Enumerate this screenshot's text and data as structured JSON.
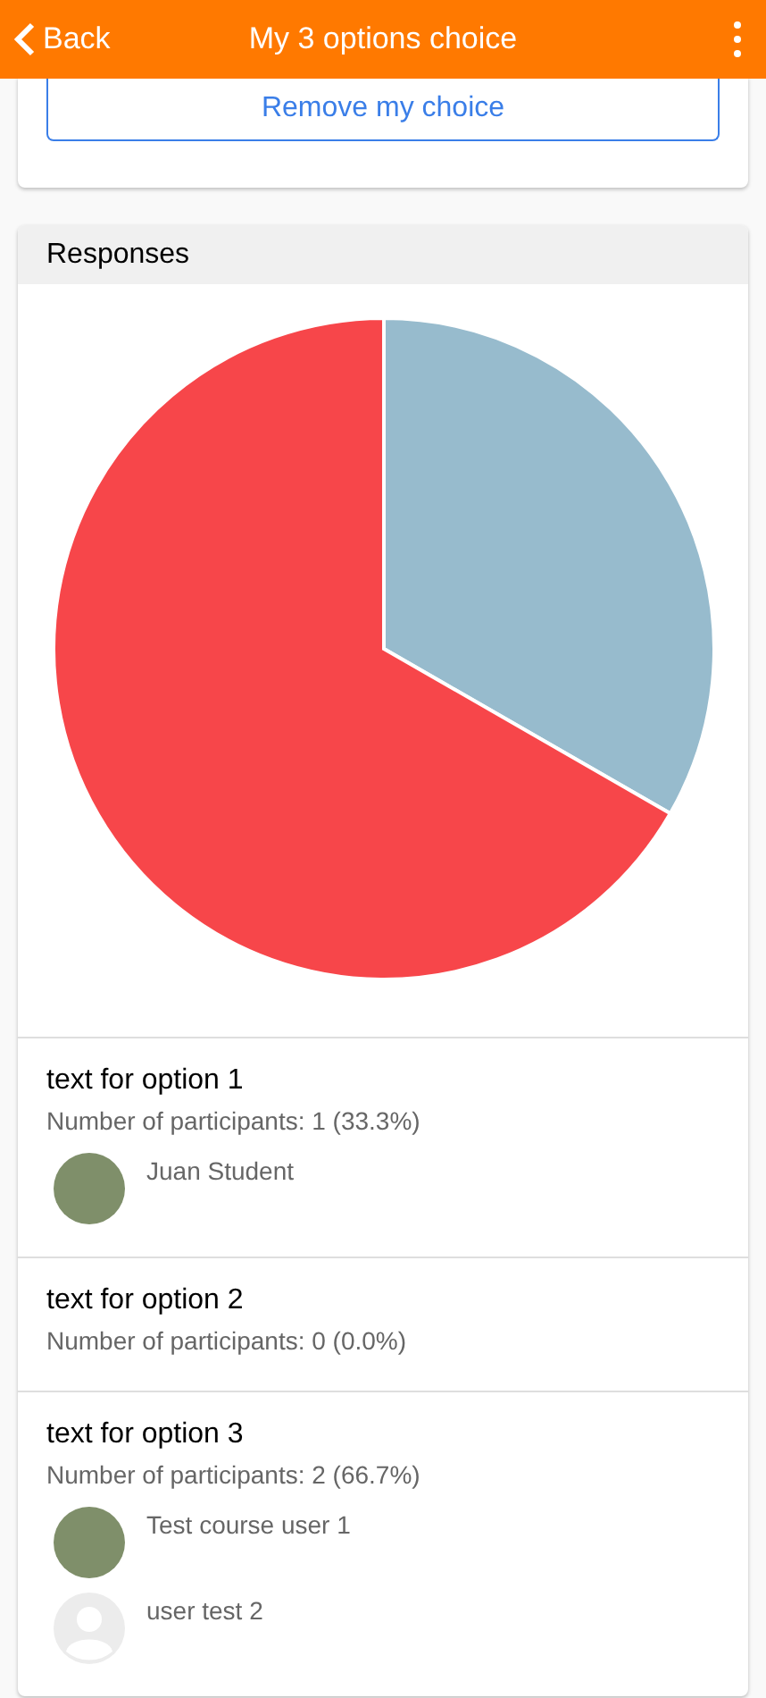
{
  "header": {
    "back": "Back",
    "title": "My 3 options choice"
  },
  "remove_button": "Remove my choice",
  "responses": {
    "title": "Responses",
    "chart_data": {
      "type": "pie",
      "values": [
        33.3,
        66.7
      ],
      "colors": [
        "#97bbcd",
        "#f7464a"
      ]
    },
    "options": [
      {
        "title": "text for option 1",
        "count": "Number of participants: 1 (33.3%)",
        "users": [
          {
            "name": "Juan Student",
            "kind": "photo"
          }
        ]
      },
      {
        "title": "text for option 2",
        "count": "Number of participants: 0 (0.0%)"
      },
      {
        "title": "text for option 3",
        "count": "Number of participants: 2 (66.7%)",
        "users": [
          {
            "name": "Test course user 1",
            "kind": "photo"
          },
          {
            "name": "user test 2",
            "kind": "default"
          }
        ]
      }
    ]
  }
}
